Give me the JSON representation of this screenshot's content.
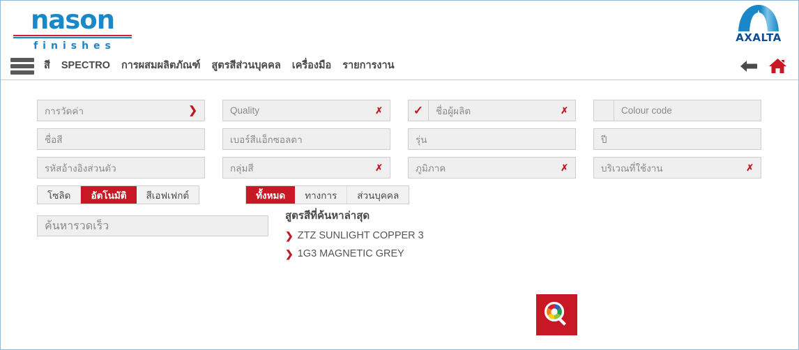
{
  "brand": {
    "logo_word": "nason",
    "logo_sub": "finishes",
    "corporate_logo_text": "AXALTA",
    "accent_red": "#c91825",
    "brand_blue": "#1a87c9",
    "corporate_blue": "#0f4c91"
  },
  "nav": {
    "menu_icon": "hamburger-icon",
    "items": [
      {
        "label": "สี",
        "name": "nav-colour"
      },
      {
        "label": "SPECTRO",
        "name": "nav-spectro"
      },
      {
        "label": "การผสมผลิตภัณฑ์",
        "name": "nav-product-mixing"
      },
      {
        "label": "สูตรสีส่วนบุคคล",
        "name": "nav-personal-formulas"
      },
      {
        "label": "เครื่องมือ",
        "name": "nav-tools"
      },
      {
        "label": "รายการงาน",
        "name": "nav-job-list"
      }
    ],
    "back_icon": "back-arrow-icon",
    "home_icon": "home-icon"
  },
  "form": {
    "rows": [
      [
        {
          "label": "การวัดค่า",
          "control": "chevron-right",
          "name": "field-measurement"
        },
        {
          "label": "Quality",
          "control": "dropdown",
          "name": "field-quality"
        },
        {
          "label": "ชื่อผู้ผลิต",
          "control": "dropdown",
          "prefix": "check",
          "name": "field-manufacturer"
        },
        {
          "label": "Colour code",
          "control": "text",
          "prefix": "empty",
          "name": "field-colour-code"
        }
      ],
      [
        {
          "label": "ชื่อสี",
          "control": "text",
          "name": "field-colour-name"
        },
        {
          "label": "เบอร์สีแอ็กซอลตา",
          "control": "text",
          "name": "field-axalta-colour-number"
        },
        {
          "label": "รุ่น",
          "control": "text",
          "name": "field-model"
        },
        {
          "label": "ปี",
          "control": "text",
          "name": "field-year"
        }
      ],
      [
        {
          "label": "รหัสอ้างอิงส่วนตัว",
          "control": "text",
          "name": "field-personal-reference-code"
        },
        {
          "label": "กลุ่มสี",
          "control": "dropdown",
          "name": "field-colour-group"
        },
        {
          "label": "ภูมิภาค",
          "control": "dropdown",
          "name": "field-region"
        },
        {
          "label": "บริเวณที่ใช้งาน",
          "control": "dropdown",
          "name": "field-application-area"
        }
      ]
    ]
  },
  "toggles": {
    "finish_group": {
      "name": "finish-type-toggle",
      "options": [
        {
          "label": "โซลิด",
          "active": false,
          "name": "toggle-solid"
        },
        {
          "label": "อัตโนมัติ",
          "active": true,
          "name": "toggle-automatic"
        },
        {
          "label": "สีเอฟเฟกต์",
          "active": false,
          "name": "toggle-effect"
        }
      ]
    },
    "scope_group": {
      "name": "formula-scope-toggle",
      "options": [
        {
          "label": "ทั้งหมด",
          "active": true,
          "name": "toggle-all"
        },
        {
          "label": "ทางการ",
          "active": false,
          "name": "toggle-official"
        },
        {
          "label": "ส่วนบุคคล",
          "active": false,
          "name": "toggle-personal"
        }
      ]
    }
  },
  "quick_search": {
    "placeholder": "ค้นหารวดเร็ว",
    "value": ""
  },
  "recent": {
    "title": "สูตรสีที่ค้นหาล่าสุด",
    "items": [
      {
        "label": "ZTZ SUNLIGHT COPPER 3"
      },
      {
        "label": "1G3 MAGNETIC GREY"
      }
    ]
  },
  "search_button": {
    "name": "colour-search-button",
    "icon": "colour-wheel-magnifier-icon"
  }
}
